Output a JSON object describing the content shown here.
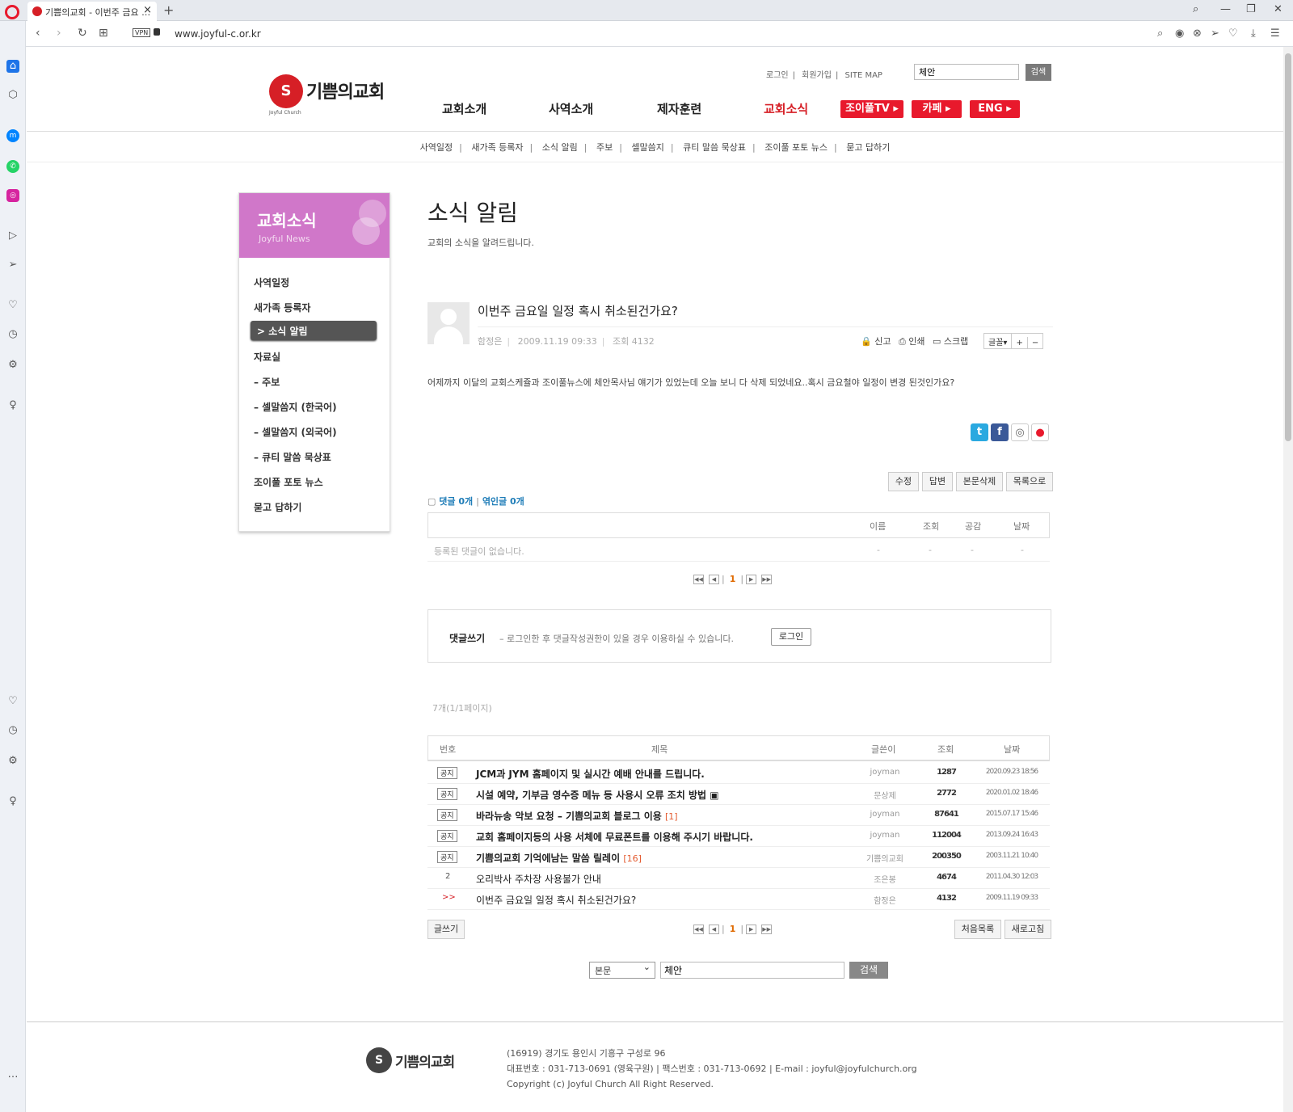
{
  "browser": {
    "tab_title": "기쁨의교회 - 이번주 금요 …",
    "url": "www.joyful-c.or.kr",
    "vpn_label": "VPN"
  },
  "site": {
    "logo_name": "기쁨의교회",
    "logo_sub": "Joyful Church",
    "top_links": [
      "로그인",
      "회원가입",
      "SITE MAP"
    ],
    "top_search_value": "체안",
    "top_search_button": "검색",
    "gnb": [
      "교회소개",
      "사역소개",
      "제자훈련",
      "교회소식"
    ],
    "gnb_active": "교회소식",
    "red_buttons": [
      "조이풀TV ▸",
      "카페 ▸",
      "ENG ▸"
    ],
    "lnb": [
      "사역일정",
      "새가족 등록자",
      "소식 알림",
      "주보",
      "셀말씀지",
      "큐티 말씀 묵상표",
      "조이풀 포토 뉴스",
      "묻고 답하기"
    ],
    "accent_color": "#d61f26",
    "snb_color": "#d077c9"
  },
  "snb": {
    "title": "교회소식",
    "subtitle": "Joyful News",
    "items": [
      "사역일정",
      "새가족 등록자",
      "> 소식 알림",
      "자료실",
      "– 주보",
      "– 셀말씀지 (한국어)",
      "– 셀말씀지 (외국어)",
      "– 큐티 말씀 묵상표",
      "조이풀 포토 뉴스",
      "묻고 답하기"
    ]
  },
  "board": {
    "title": "소식 알림",
    "desc": "교회의 소식을 알려드립니다.",
    "post": {
      "title": "이번주 금요일 일정 혹시 취소된건가요?",
      "author": "함정은",
      "date": "2009.11.19 09:33",
      "views": "조회 4132",
      "tools": [
        "신고",
        "인쇄",
        "스크랩"
      ],
      "font_label": "글꼴",
      "font_plus": "+",
      "font_minus": "−",
      "body": "어제까지 이달의 교회스케쥴과 조이풀뉴스에 체안목사님 얘기가 있었는데 오늘 보니 다 삭제 되었네요..혹시 금요철야 일정이 변경 된것인가요?"
    },
    "sns": [
      "t",
      "f",
      "◎",
      "●"
    ],
    "action_buttons": [
      "수정",
      "답변",
      "본문삭제",
      "목록으로"
    ],
    "comment_count": "댓글 0개",
    "trackback_count": "엮인글 0개",
    "comment_cols": [
      "이름",
      "조회",
      "공감",
      "날짜"
    ],
    "comment_empty": "등록된 댓글이 없습니다.",
    "dash": "-",
    "pager": {
      "first": "◀◀",
      "prev": "◀",
      "current": "1",
      "next": "▶",
      "last": "▶▶"
    },
    "write_label": "댓글쓰기",
    "write_desc": "– 로그인한 후 댓글작성권한이 있을 경우 이용하실 수 있습니다.",
    "write_login": "로그인",
    "list_info": "7개(1/1페이지)",
    "list_cols": [
      "번호",
      "제목",
      "글쓴이",
      "조회",
      "날짜"
    ],
    "rows": [
      {
        "no": "공지",
        "subject": "JCM과 JYM 홈페이지 및 실시간 예배 안내를 드립니다.",
        "count": "",
        "author": "joyman",
        "views": "1287",
        "date": "2020.09.23 18:56"
      },
      {
        "no": "공지",
        "subject": "시설 예약, 기부금 영수증 메뉴 등 사용시 오류 조치 방법 ▣",
        "count": "",
        "author": "문상제",
        "views": "2772",
        "date": "2020.01.02 18:46"
      },
      {
        "no": "공지",
        "subject": "바라뉴송 악보 요청 – 기쁨의교회 블로그 이용",
        "count": "[1]",
        "author": "joyman",
        "views": "87641",
        "date": "2015.07.17 15:46"
      },
      {
        "no": "공지",
        "subject": "교회 홈페이지등의 사용 서체에 무료폰트를 이용해 주시기 바랍니다.",
        "count": "",
        "author": "joyman",
        "views": "112004",
        "date": "2013.09.24 16:43"
      },
      {
        "no": "공지",
        "subject": "기쁨의교회 기억에남는 말씀 릴레이",
        "count": "[16]",
        "author": "기쁨의교회",
        "views": "200350",
        "date": "2003.11.21 10:40"
      },
      {
        "no": "2",
        "subject": "오리박사 주차장 사용불가 안내",
        "count": "",
        "author": "조은봉",
        "views": "4674",
        "date": "2011.04.30 12:03"
      },
      {
        "no": ">>",
        "subject": "이번주 금요일 일정 혹시 취소된건가요?",
        "count": "",
        "author": "함정은",
        "views": "4132",
        "date": "2009.11.19 09:33"
      }
    ],
    "write_button": "글쓰기",
    "list_buttons": [
      "처음목록",
      "새로고침"
    ],
    "search_select": "본문",
    "search_value": "체안",
    "search_button": "검색"
  },
  "footer": {
    "logo_name": "기쁨의교회",
    "lines": [
      "(16919) 경기도 용인시 기흥구 구성로 96",
      "대표번호 : 031-713-0691 (영육구원) | 팩스번호 : 031-713-0692 | E-mail : joyful@joyfulchurch.org",
      "Copyright (c) Joyful Church All Right Reserved."
    ]
  }
}
